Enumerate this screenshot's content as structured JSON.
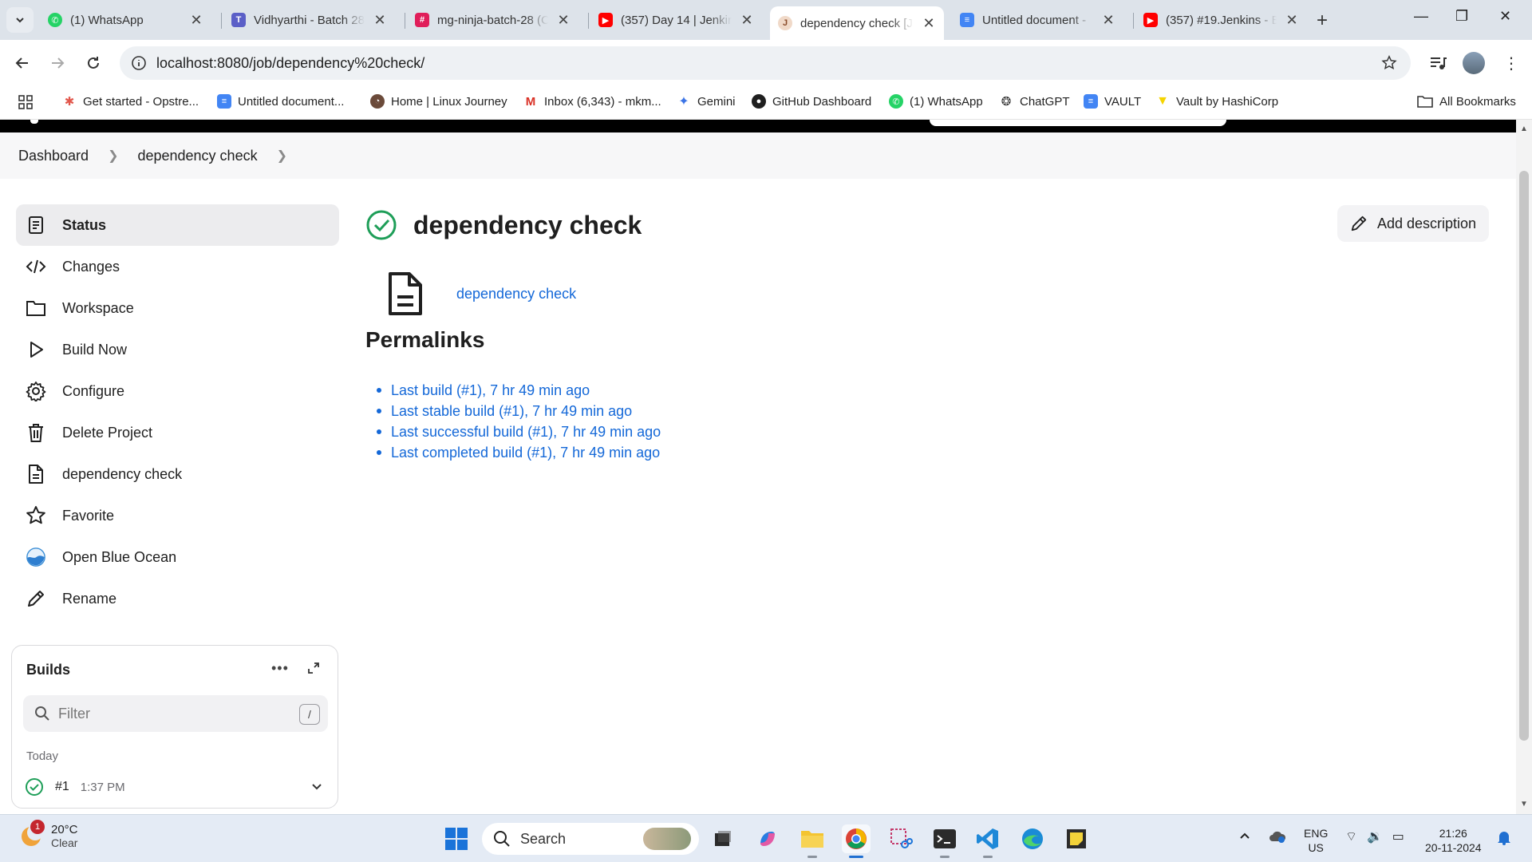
{
  "browser": {
    "tabs": [
      {
        "title": "(1) WhatsApp",
        "icon": "whatsapp-icon",
        "color": "#25d366"
      },
      {
        "title": "Vidhyarthi - Batch 28",
        "icon": "teams-icon",
        "color": "#5b5fc7"
      },
      {
        "title": "mg-ninja-batch-28 (C",
        "icon": "slack-icon",
        "color": "#e01e5a"
      },
      {
        "title": "(357) Day 14 | Jenkins",
        "icon": "youtube-icon",
        "color": "#ff0000"
      },
      {
        "title": "dependency check [J",
        "icon": "jenkins-icon",
        "color": "#d33833",
        "active": true
      },
      {
        "title": "Untitled document -",
        "icon": "docs-icon",
        "color": "#4285f4"
      },
      {
        "title": "(357) #19.Jenkins - B",
        "icon": "youtube-icon",
        "color": "#ff0000"
      }
    ],
    "url": "localhost:8080/job/dependency%20check/",
    "bookmarks": [
      {
        "label": "Get started - Opstre...",
        "icon": "opstree-icon"
      },
      {
        "label": "Untitled document...",
        "icon": "docs-icon"
      },
      {
        "label": "Home | Linux Journey",
        "icon": "linux-journey-icon"
      },
      {
        "label": "Inbox (6,343) - mkm...",
        "icon": "gmail-icon"
      },
      {
        "label": "Gemini",
        "icon": "gemini-icon"
      },
      {
        "label": "GitHub Dashboard",
        "icon": "github-icon"
      },
      {
        "label": "(1) WhatsApp",
        "icon": "whatsapp-icon"
      },
      {
        "label": "ChatGPT",
        "icon": "chatgpt-icon"
      },
      {
        "label": "VAULT",
        "icon": "docs-icon"
      },
      {
        "label": "Vault by HashiCorp",
        "icon": "vault-icon"
      }
    ],
    "all_bookmarks": "All Bookmarks"
  },
  "jenkins": {
    "breadcrumbs": [
      "Dashboard",
      "dependency check"
    ],
    "sidebar": [
      {
        "label": "Status",
        "icon": "status-icon",
        "active": true
      },
      {
        "label": "Changes",
        "icon": "code-icon"
      },
      {
        "label": "Workspace",
        "icon": "folder-icon"
      },
      {
        "label": "Build Now",
        "icon": "play-icon"
      },
      {
        "label": "Configure",
        "icon": "gear-icon"
      },
      {
        "label": "Delete Project",
        "icon": "trash-icon"
      },
      {
        "label": "dependency check",
        "icon": "document-icon"
      },
      {
        "label": "Favorite",
        "icon": "star-icon"
      },
      {
        "label": "Open Blue Ocean",
        "icon": "blue-ocean-icon"
      },
      {
        "label": "Rename",
        "icon": "pencil-icon"
      }
    ],
    "builds": {
      "title": "Builds",
      "filter_placeholder": "Filter",
      "shortcut": "/",
      "group": "Today",
      "items": [
        {
          "number": "#1",
          "time": "1:37 PM",
          "status": "success"
        }
      ]
    },
    "title": "dependency check",
    "add_description": "Add description",
    "artifact_link": "dependency check",
    "permalinks_title": "Permalinks",
    "permalinks": [
      "Last build (#1), 7 hr 49 min ago",
      "Last stable build (#1), 7 hr 49 min ago",
      "Last successful build (#1), 7 hr 49 min ago",
      "Last completed build (#1), 7 hr 49 min ago"
    ]
  },
  "taskbar": {
    "weather_temp": "20°C",
    "weather_cond": "Clear",
    "weather_badge": "1",
    "search": "Search",
    "lang": "ENG",
    "region": "US",
    "time": "21:26",
    "date": "20-11-2024"
  }
}
